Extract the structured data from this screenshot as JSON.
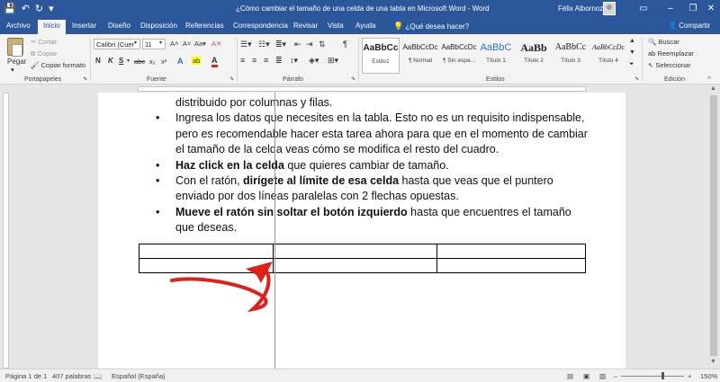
{
  "title_bar": {
    "title": "¿Cómo cambiar el tamaño de una celda de una tabla en Microsoft Word - Word",
    "user": "Félix Albornoz",
    "buttons": {
      "save": "💾",
      "undo": "↶",
      "redo": "↻",
      "customize": "▾",
      "ribbon_options": "▭",
      "minimize": "–",
      "maximize": "❐",
      "close": "✕"
    }
  },
  "tabs": [
    "Archivo",
    "Inicio",
    "Insertar",
    "Diseño",
    "Disposición",
    "Referencias",
    "Correspondencia",
    "Revisar",
    "Vista",
    "Ayuda"
  ],
  "tell_me": "¿Qué desea hacer?",
  "share": "Compartir",
  "ribbon": {
    "clipboard": {
      "paste": "Pegar",
      "cut": "Cortar",
      "copy": "Copiar",
      "format_painter": "Copiar formato",
      "label": "Portapapeles"
    },
    "font": {
      "name": "Calibri (Cuer",
      "size": "11",
      "grow": "A˄",
      "shrink": "A˅",
      "case": "Aa▾",
      "clear": "A✕",
      "bold": "N",
      "italic": "K",
      "underline": "S",
      "strike": "abc",
      "subscript": "x₂",
      "superscript": "x²",
      "effects": "A",
      "highlight": "ab",
      "color": "A",
      "label": "Fuente"
    },
    "paragraph": {
      "label": "Párrafo"
    },
    "styles": {
      "label": "Estilos",
      "items": [
        {
          "sample": "AaBbCc",
          "name": "Estilo1"
        },
        {
          "sample": "AaBbCcDc",
          "name": "¶ Normal"
        },
        {
          "sample": "AaBbCcDc",
          "name": "¶ Sin espa..."
        },
        {
          "sample": "AaBbC",
          "name": "Título 1"
        },
        {
          "sample": "AaBb",
          "name": "Título 2"
        },
        {
          "sample": "AaBbCc",
          "name": "Título 3"
        },
        {
          "sample": "AaBbCcDc",
          "name": "Título 4"
        }
      ]
    },
    "editing": {
      "find": "Buscar",
      "replace": "Reemplazar",
      "select": "Seleccionar",
      "label": "Edición"
    }
  },
  "document": {
    "line0": "distribuido por columnas y filas.",
    "bullets": [
      {
        "bold": "",
        "text": "Ingresa los datos que necesites en la tabla. Esto no es un requisito indispensable, pero es recomendable hacer esta tarea ahora para que en el momento de cambiar el tamaño de la celda veas cómo se modifica el resto del cuadro.",
        "bold_mid": "",
        "text_end": ""
      },
      {
        "bold": "Haz click en la celda",
        "text": " que quieres cambiar de tamaño.",
        "bold_mid": "",
        "text_end": ""
      },
      {
        "bold": "",
        "text": "Con el ratón, ",
        "bold_mid": "dirígete al límite de esa celda",
        "text_end": " hasta que veas que el puntero enviado por dos líneas paralelas con 2 flechas opuestas."
      },
      {
        "bold": "Mueve el ratón sin soltar el botón izquierdo",
        "text": " hasta que encuentres el tamaño que deseas.",
        "bold_mid": "",
        "text_end": ""
      }
    ],
    "bullet_char": "•"
  },
  "status": {
    "page": "Página 1 de 1",
    "words": "407 palabras",
    "language": "Español (España)",
    "zoom_out": "–",
    "zoom_in": "+",
    "zoom": "150%"
  },
  "colors": {
    "accent": "#2b579a",
    "arrow": "#e0201b"
  }
}
